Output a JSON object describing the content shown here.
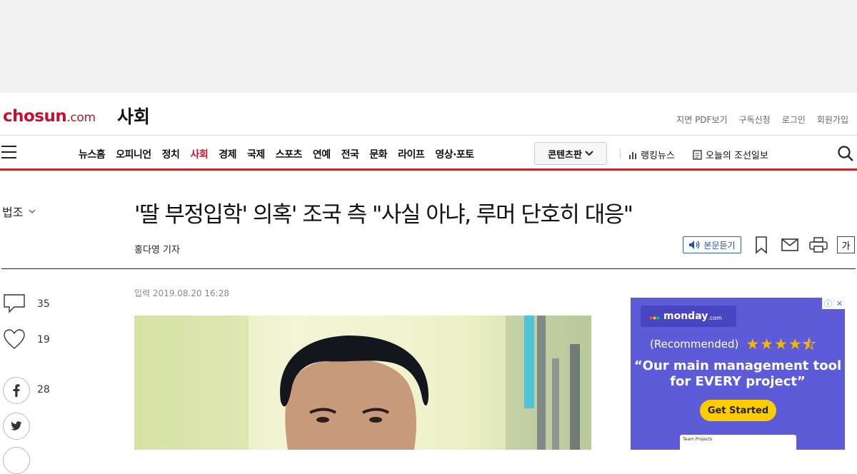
{
  "header": {
    "logo_main": "chosun",
    "logo_suffix": ".com",
    "section": "사회",
    "links": [
      "지면 PDF보기",
      "구독신청",
      "로그인",
      "회원가입"
    ]
  },
  "nav": {
    "items": [
      "뉴스홈",
      "오피니언",
      "정치",
      "사회",
      "경제",
      "국제",
      "스포츠",
      "연예",
      "전국",
      "문화",
      "라이프",
      "영상·포토"
    ],
    "active": "사회",
    "content_button": "콘텐츠판",
    "ranking": "랭킹뉴스",
    "today_paper": "오늘의 조선일보",
    "accent_color": "#c0282d"
  },
  "article": {
    "category": "법조",
    "headline": "'딸 부정입학' 의혹' 조국 측 \"사실 아냐, 루머 단호히 대응\"",
    "byline": "홍다영 기자",
    "listen_label": "본문듣기",
    "fontsize_label": "가",
    "date": "입력 2019.08.20 16:28"
  },
  "side": {
    "comments": "35",
    "likes": "19",
    "facebook": "28"
  },
  "ad": {
    "brand": "monday",
    "brand_suffix": ".com",
    "recommended": "(Recommended)",
    "rating": 4.5,
    "quote_line1": "“Our main management tool",
    "quote_line2": "for EVERY project”",
    "cta": "Get Started",
    "card_title": "Team Projects",
    "bg_color": "#5e5bd8",
    "cta_color": "#ffcc00"
  }
}
